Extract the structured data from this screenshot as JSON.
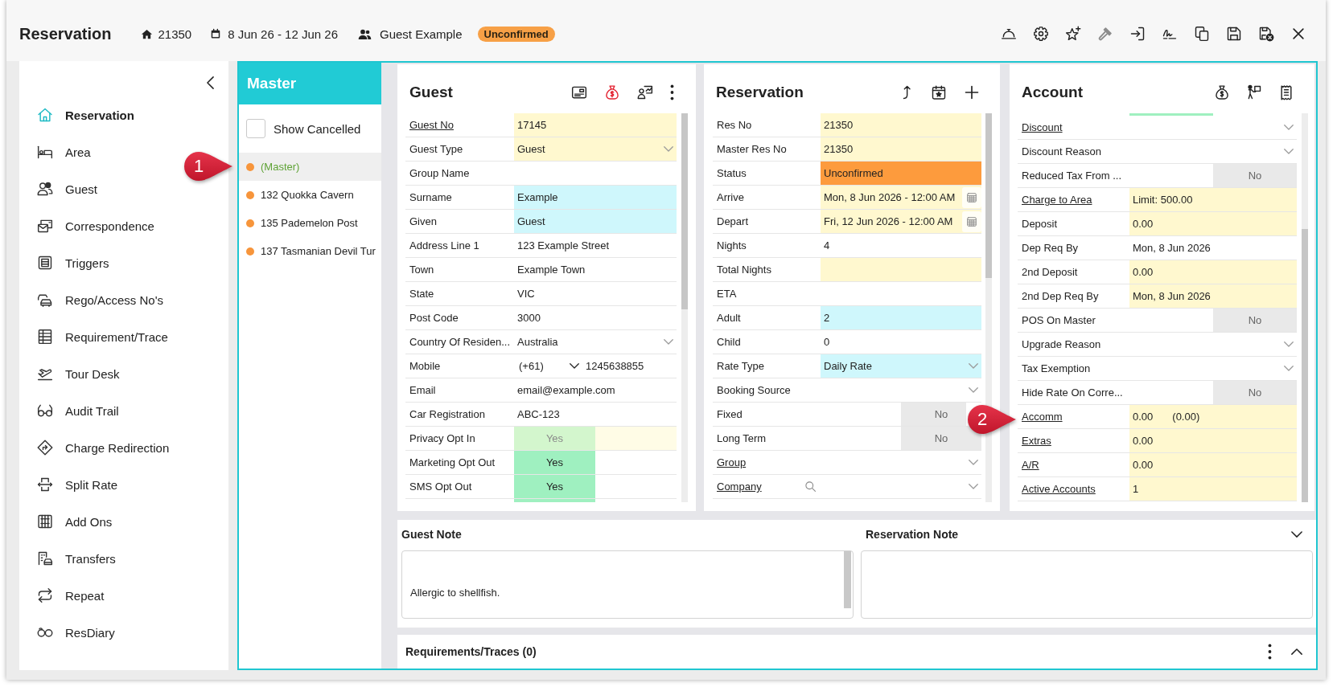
{
  "header": {
    "title": "Reservation",
    "number": "21350",
    "date_range": "8 Jun 26 - 12 Jun 26",
    "guest_name": "Guest Example",
    "status": "Unconfirmed"
  },
  "sidebar": {
    "items": [
      {
        "label": "Reservation",
        "selected": true
      },
      {
        "label": "Area",
        "selected": false
      },
      {
        "label": "Guest",
        "selected": false
      },
      {
        "label": "Correspondence",
        "selected": false
      },
      {
        "label": "Triggers",
        "selected": false
      },
      {
        "label": "Rego/Access No's",
        "selected": false
      },
      {
        "label": "Requirement/Trace",
        "selected": false
      },
      {
        "label": "Tour Desk",
        "selected": false
      },
      {
        "label": "Audit Trail",
        "selected": false
      },
      {
        "label": "Charge Redirection",
        "selected": false
      },
      {
        "label": "Split Rate",
        "selected": false
      },
      {
        "label": "Add Ons",
        "selected": false
      },
      {
        "label": "Transfers",
        "selected": false
      },
      {
        "label": "Repeat",
        "selected": false
      },
      {
        "label": "ResDiary",
        "selected": false
      }
    ]
  },
  "master": {
    "title": "Master",
    "show_cancelled": {
      "label": "Show Cancelled",
      "checked": false
    },
    "items": [
      {
        "label": "(Master)",
        "selected": true
      },
      {
        "label": "132 Quokka Cavern",
        "selected": false
      },
      {
        "label": "135 Pademelon Post",
        "selected": false
      },
      {
        "label": "137 Tasmanian Devil Tur",
        "selected": false
      }
    ]
  },
  "guest": {
    "title": "Guest",
    "fields": [
      {
        "label": "Guest No",
        "link": true,
        "kind": "text",
        "value": "17145",
        "color": "#fff8cf"
      },
      {
        "label": "Guest Type",
        "link": false,
        "kind": "select",
        "value": "Guest",
        "color": "#fff8cf"
      },
      {
        "label": "Group Name",
        "link": false,
        "kind": "text"
      },
      {
        "label": "Surname",
        "link": false,
        "kind": "text",
        "value": "Example",
        "color": "#cff7fc"
      },
      {
        "label": "Given",
        "link": false,
        "kind": "text",
        "value": "Guest",
        "color": "#cff7fc"
      },
      {
        "label": "Address Line 1",
        "link": false,
        "kind": "text",
        "value": "123 Example Street"
      },
      {
        "label": "Town",
        "link": false,
        "kind": "text",
        "value": "Example Town"
      },
      {
        "label": "State",
        "link": false,
        "kind": "text",
        "value": "VIC"
      },
      {
        "label": "Post Code",
        "link": false,
        "kind": "text",
        "value": "3000"
      },
      {
        "label": "Country Of Residen...",
        "link": false,
        "kind": "select",
        "value": "Australia"
      },
      {
        "label": "Mobile",
        "link": false,
        "kind": "phone",
        "prefix": "(+61)",
        "value": "1245638855"
      },
      {
        "label": "Email",
        "link": false,
        "kind": "text",
        "value": "email@example.com"
      },
      {
        "label": "Car Registration",
        "link": false,
        "kind": "text",
        "value": "ABC-123"
      },
      {
        "label": "Privacy Opt In",
        "link": false,
        "kind": "toggle",
        "value": "Yes",
        "on": true,
        "disabled": true,
        "color": "#fffce6"
      },
      {
        "label": "Marketing Opt Out",
        "link": false,
        "kind": "toggle",
        "value": "Yes",
        "on": true,
        "disabled": false
      },
      {
        "label": "SMS Opt Out",
        "link": false,
        "kind": "toggle",
        "value": "Yes",
        "on": true,
        "disabled": false
      }
    ]
  },
  "reservation": {
    "title": "Reservation",
    "fields": [
      {
        "label": "Res No",
        "link": false,
        "kind": "text",
        "value": "21350",
        "color": "#fff8cf"
      },
      {
        "label": "Master Res No",
        "link": false,
        "kind": "text",
        "value": "21350",
        "color": "#fff8cf"
      },
      {
        "label": "Status",
        "link": false,
        "kind": "text",
        "value": "Unconfirmed",
        "color": "#fd9b3d"
      },
      {
        "label": "Arrive",
        "link": false,
        "kind": "date",
        "value": "Mon, 8 Jun 2026 - 12:00 AM",
        "color": "#fff8cf"
      },
      {
        "label": "Depart",
        "link": false,
        "kind": "date",
        "value": "Fri, 12 Jun 2026 - 12:00 AM",
        "color": "#fff8cf"
      },
      {
        "label": "Nights",
        "link": false,
        "kind": "text",
        "value": "4"
      },
      {
        "label": "Total Nights",
        "link": false,
        "kind": "text",
        "color": "#fff8cf"
      },
      {
        "label": "ETA",
        "link": false,
        "kind": "text"
      },
      {
        "label": "Adult",
        "link": false,
        "kind": "text",
        "value": "2",
        "color": "#cff7fc"
      },
      {
        "label": "Child",
        "link": false,
        "kind": "text",
        "value": "0"
      },
      {
        "label": "Rate Type",
        "link": false,
        "kind": "select",
        "value": "Daily Rate",
        "color": "#cff7fc"
      },
      {
        "label": "Booking Source",
        "link": false,
        "kind": "select"
      },
      {
        "label": "Fixed",
        "link": false,
        "kind": "toggle",
        "value": "No",
        "on": false,
        "disabled": false
      },
      {
        "label": "Long Term",
        "link": false,
        "kind": "toggle",
        "value": "No",
        "on": false,
        "disabled": false
      },
      {
        "label": "Group",
        "link": true,
        "kind": "select"
      },
      {
        "label": "Company",
        "link": true,
        "kind": "search-select"
      }
    ]
  },
  "account": {
    "title": "Account",
    "fields": [
      {
        "label": "Discount",
        "link": true,
        "kind": "select"
      },
      {
        "label": "Discount Reason",
        "link": false,
        "kind": "select"
      },
      {
        "label": "Reduced Tax From ...",
        "link": false,
        "kind": "toggle",
        "value": "No",
        "on": false,
        "disabled": false
      },
      {
        "label": "Charge to Area",
        "link": true,
        "kind": "text",
        "value": "Limit: 500.00",
        "color": "#fff8cf"
      },
      {
        "label": "Deposit",
        "link": false,
        "kind": "text",
        "value": "0.00",
        "color": "#fff8cf"
      },
      {
        "label": "Dep Req By",
        "link": false,
        "kind": "text",
        "value": "Mon, 8 Jun 2026"
      },
      {
        "label": "2nd Deposit",
        "link": false,
        "kind": "text",
        "value": "0.00",
        "color": "#fff8cf"
      },
      {
        "label": "2nd Dep Req By",
        "link": false,
        "kind": "text",
        "value": "Mon, 8 Jun 2026",
        "color": "#fff8cf"
      },
      {
        "label": "POS On Master",
        "link": false,
        "kind": "toggle",
        "value": "No",
        "on": false,
        "disabled": false
      },
      {
        "label": "Upgrade Reason",
        "link": false,
        "kind": "select"
      },
      {
        "label": "Tax Exemption",
        "link": false,
        "kind": "select"
      },
      {
        "label": "Hide Rate On Corre...",
        "link": false,
        "kind": "toggle",
        "value": "No",
        "on": false,
        "disabled": false
      },
      {
        "label": "Accomm",
        "link": true,
        "kind": "text",
        "value": "0.00",
        "secondary": "(0.00)",
        "color": "#fff8cf"
      },
      {
        "label": "Extras",
        "link": true,
        "kind": "text",
        "value": "0.00",
        "color": "#fff8cf"
      },
      {
        "label": "A/R",
        "link": true,
        "kind": "text",
        "value": "0.00",
        "color": "#fff8cf"
      },
      {
        "label": "Active Accounts",
        "link": true,
        "kind": "text",
        "value": "1",
        "color": "#fff8cf"
      }
    ]
  },
  "notes": {
    "expanded": true,
    "guest_note": {
      "title": "Guest Note",
      "value": "Allergic to shellfish."
    },
    "reservation_note": {
      "title": "Reservation Note"
    }
  },
  "requirements": {
    "title": "Requirements/Traces (0)",
    "expanded": false
  },
  "callouts": [
    {
      "label": "1"
    },
    {
      "label": "2"
    }
  ]
}
